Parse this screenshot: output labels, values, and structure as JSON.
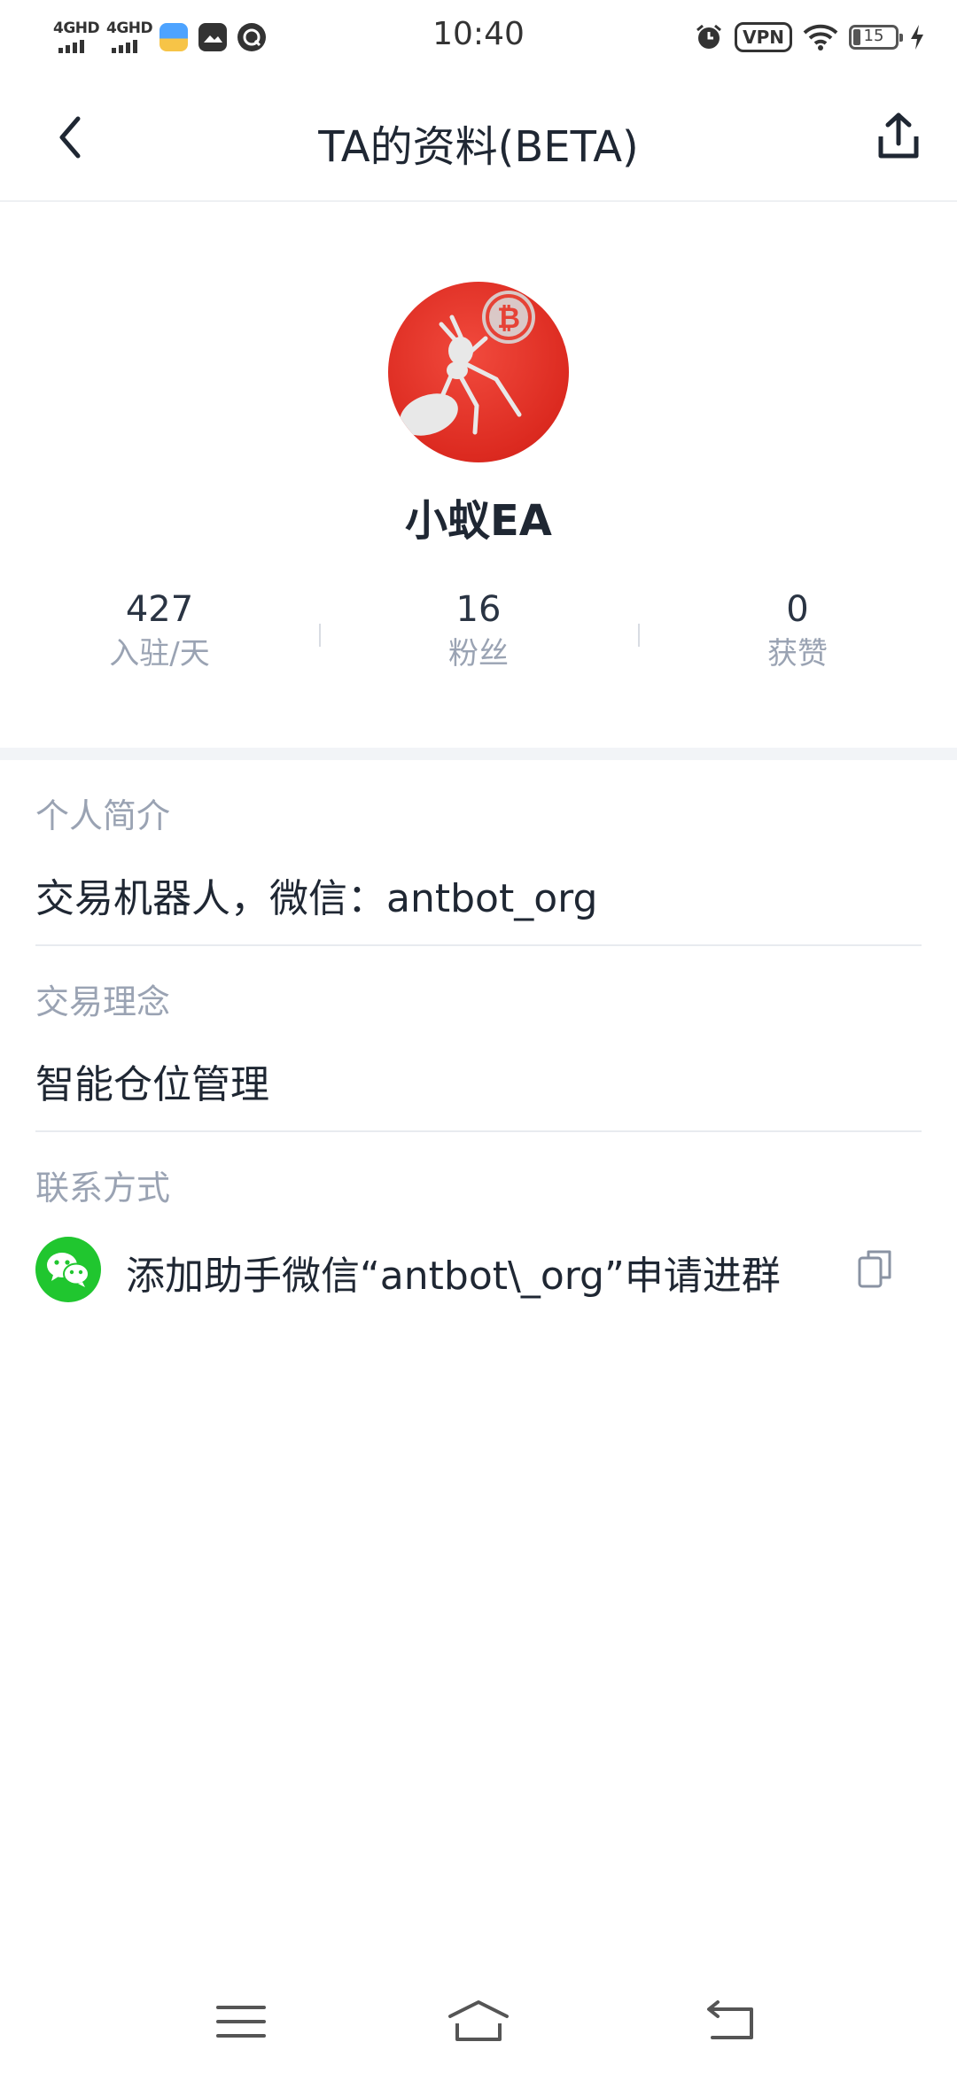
{
  "status_bar": {
    "signal1_label": "4GHD",
    "signal2_label": "4GHD",
    "time": "10:40",
    "vpn_label": "VPN",
    "battery_level": "15",
    "icons": [
      "signal-4g-icon",
      "signal-4g-icon",
      "weather-app-icon",
      "gallery-app-icon",
      "browser-app-icon",
      "alarm-icon",
      "vpn-icon",
      "wifi-icon",
      "battery-icon",
      "charging-icon"
    ]
  },
  "nav": {
    "title": "TA的资料(BETA)",
    "back_icon": "chevron-left-icon",
    "share_icon": "share-icon"
  },
  "profile": {
    "avatar_icon": "ant-bitcoin-avatar",
    "username": "小蚁EA",
    "stats": [
      {
        "value": "427",
        "label": "入驻/天"
      },
      {
        "value": "16",
        "label": "粉丝"
      },
      {
        "value": "0",
        "label": "获赞"
      }
    ]
  },
  "sections": {
    "bio_label": "个人简介",
    "bio_text": "交易机器人，微信：antbot_org",
    "philosophy_label": "交易理念",
    "philosophy_text": "智能仓位管理",
    "contact_label": "联系方式",
    "contact_text": "添加助手微信“antbot\\_org”申请进群",
    "contact_icon": "wechat-icon",
    "copy_icon": "copy-icon"
  },
  "colors": {
    "accent_red": "#dc2a20",
    "wechat_green": "#20c62f",
    "muted_text": "#9aa3b3",
    "primary_text": "#1f2733"
  }
}
